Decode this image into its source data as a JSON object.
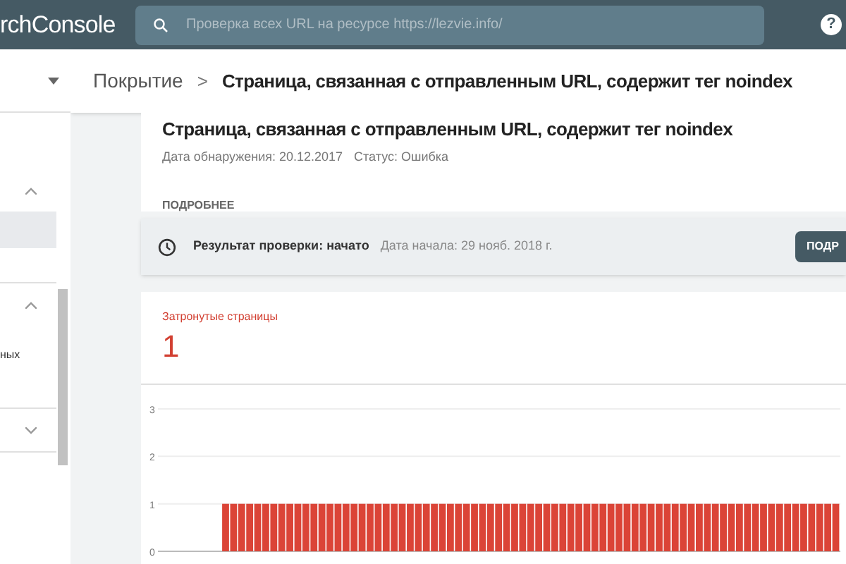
{
  "header": {
    "logo": "rchConsole",
    "search": {
      "placeholder": "Проверка всех URL на ресурсе https://lezvie.info/"
    },
    "help": "?"
  },
  "breadcrumb": {
    "parent": "Покрытие",
    "separator": ">",
    "current": "Страница, связанная с отправленным URL, содержит тег noindex"
  },
  "sidebar": {
    "sections": [
      {
        "expanded": true,
        "items": [
          {
            "selected": true
          }
        ]
      },
      {
        "expanded": true,
        "items": [
          {
            "label": "ных",
            "selected": false
          }
        ]
      },
      {
        "expanded": false
      }
    ]
  },
  "issue": {
    "title": "Страница, связанная с отправленным URL, содержит тег noindex",
    "detected": "Дата обнаружения: 20.12.2017",
    "status": "Статус: Ошибка",
    "more": "ПОДРОБНЕЕ"
  },
  "validation": {
    "result": "Результат проверки: начато",
    "started": "Дата начала: 29 нояб. 2018 г.",
    "button": "ПОДР"
  },
  "affected": {
    "label": "Затронутые страницы",
    "count": "1",
    "chart_data": {
      "type": "bar",
      "ylim": [
        0,
        3
      ],
      "yticks": [
        0,
        1,
        2,
        3
      ],
      "values": [
        null,
        null,
        null,
        null,
        null,
        null,
        null,
        null,
        1,
        1,
        1,
        1,
        1,
        1,
        1,
        1,
        1,
        1,
        1,
        1,
        1,
        1,
        1,
        1,
        1,
        1,
        1,
        1,
        1,
        1,
        1,
        1,
        1,
        1,
        1,
        1,
        1,
        1,
        1,
        1,
        1,
        1,
        1,
        1,
        1,
        1,
        1,
        1,
        1,
        1,
        1,
        1,
        1,
        1,
        1,
        1,
        1,
        1,
        1,
        1,
        1,
        1,
        1,
        1,
        1,
        1,
        1,
        1,
        1,
        1,
        1,
        1,
        1,
        1,
        1,
        1,
        1,
        1,
        1,
        1,
        1,
        1,
        1,
        1,
        1
      ]
    }
  }
}
